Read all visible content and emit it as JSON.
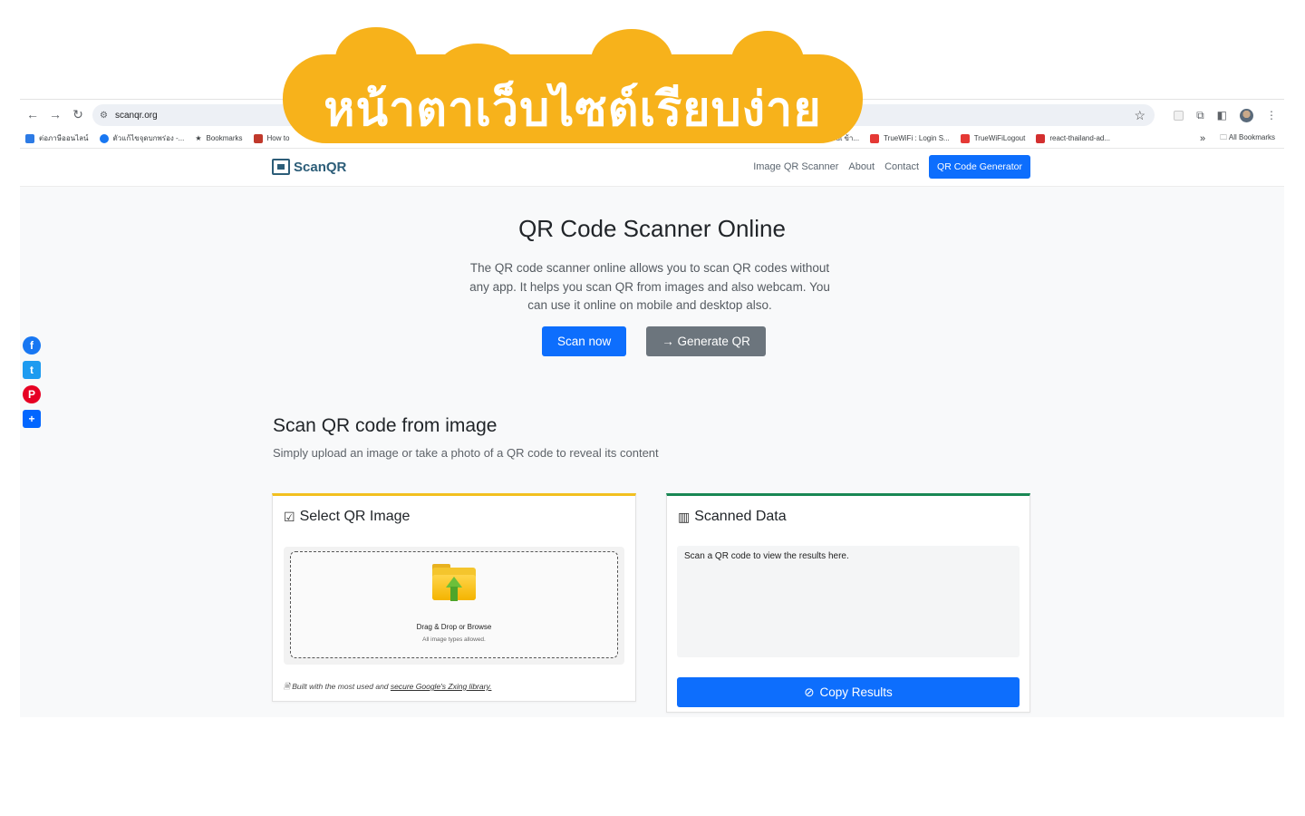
{
  "overlay": {
    "caption": "หน้าตาเว็บไซต์เรียบง่าย"
  },
  "browser": {
    "url": "scanqr.org",
    "bookmarks": [
      {
        "label": "ต่อภาษีออนไลน์",
        "color": "#2d7be5"
      },
      {
        "label": "ตัวแก้ไขจุดบกพร่อง -...",
        "color": "#1877f2"
      },
      {
        "label": "Bookmarks",
        "color": "#5f6368"
      },
      {
        "label": "How to",
        "color": "#c0392b"
      },
      {
        "label": "...out ข้า...",
        "color": "#d9534f"
      },
      {
        "label": "TrueWiFi : Login S...",
        "color": "#e53935"
      },
      {
        "label": "TrueWiFiLogout",
        "color": "#e53935"
      },
      {
        "label": "react-thailand-ad...",
        "color": "#d32f2f"
      }
    ],
    "all_bookmarks": "All Bookmarks"
  },
  "site": {
    "logo": "ScanQR",
    "nav": [
      "Image QR Scanner",
      "About",
      "Contact"
    ],
    "nav_cta": "QR Code Generator"
  },
  "hero": {
    "title": "QR Code Scanner Online",
    "description": "The QR code scanner online allows you to scan QR codes without any app. It helps you scan QR from images and also webcam. You can use it online on mobile and desktop also.",
    "scan_button": "Scan now",
    "generate_button": "→ Generate QR"
  },
  "section": {
    "title": "Scan QR code from image",
    "subtitle": "Simply upload an image or take a photo of a QR code to reveal its content"
  },
  "select_card": {
    "title": "Select QR Image",
    "drop_title": "Drag & Drop or Browse",
    "drop_sub": "All image types allowed.",
    "footnote_prefix": "Built with the most used and ",
    "footnote_link": "secure Google's Zxing library."
  },
  "result_card": {
    "title": "Scanned Data",
    "placeholder": "Scan a QR code to view the results here.",
    "copy_button": "Copy Results"
  },
  "share": [
    {
      "icon": "facebook-icon",
      "glyph": "f",
      "color": "#1877f2"
    },
    {
      "icon": "twitter-icon",
      "glyph": "t",
      "color": "#1d9bf0"
    },
    {
      "icon": "pinterest-icon",
      "glyph": "P",
      "color": "#e60023"
    },
    {
      "icon": "share-plus-icon",
      "glyph": "+",
      "color": "#0166ff"
    }
  ],
  "colors": {
    "primary": "#0d6efd",
    "secondary": "#6c757d",
    "select_accent": "#f2c01f",
    "result_accent": "#198754",
    "banner": "#f7b21b"
  }
}
